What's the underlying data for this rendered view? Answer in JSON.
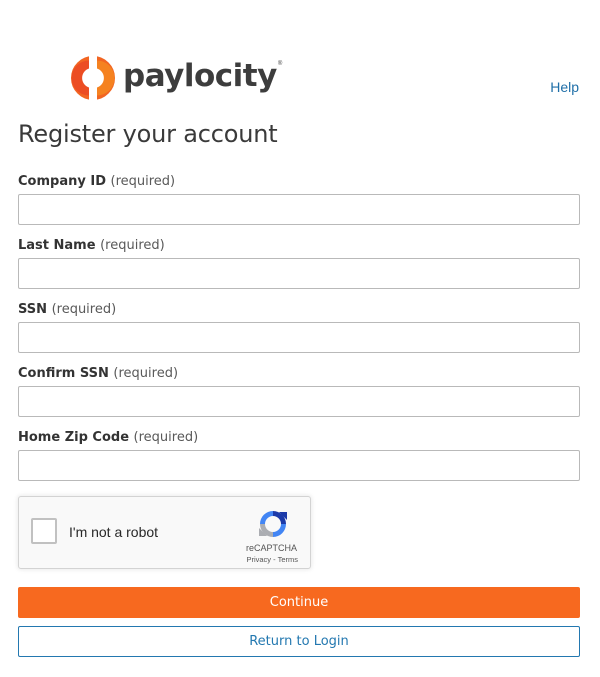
{
  "brand": {
    "name": "paylocity",
    "trademark": "®",
    "accent_color": "#f7691f",
    "logo_icon": "paylocity-logo-icon"
  },
  "header": {
    "help_label": "Help"
  },
  "page": {
    "title": "Register your account"
  },
  "form": {
    "required_text": "(required)",
    "fields": [
      {
        "label": "Company ID",
        "value": "",
        "placeholder": ""
      },
      {
        "label": "Last Name",
        "value": "",
        "placeholder": ""
      },
      {
        "label": "SSN",
        "value": "",
        "placeholder": ""
      },
      {
        "label": "Confirm SSN",
        "value": "",
        "placeholder": ""
      },
      {
        "label": "Home Zip Code",
        "value": "",
        "placeholder": ""
      }
    ]
  },
  "captcha": {
    "label": "I'm not a robot",
    "brand": "reCAPTCHA",
    "privacy": "Privacy",
    "separator": " - ",
    "terms": "Terms",
    "icon": "recaptcha-icon"
  },
  "actions": {
    "continue_label": "Continue",
    "return_label": "Return to Login"
  },
  "colors": {
    "link": "#2378b0",
    "primary_button": "#f7691f"
  }
}
